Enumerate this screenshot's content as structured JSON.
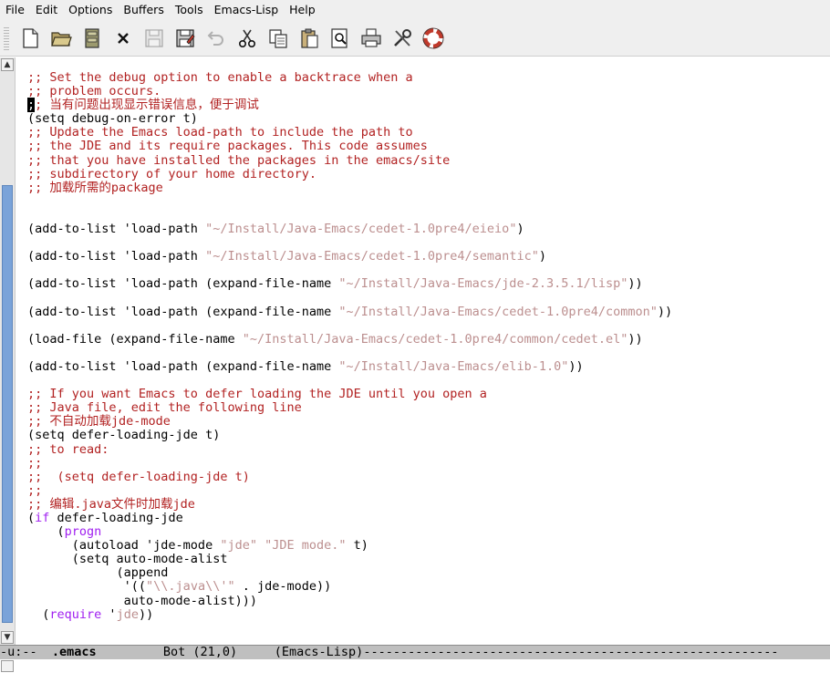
{
  "menubar": {
    "items": [
      "File",
      "Edit",
      "Options",
      "Buffers",
      "Tools",
      "Emacs-Lisp",
      "Help"
    ]
  },
  "toolbar": {
    "buttons": [
      {
        "icon": "new-file-icon"
      },
      {
        "icon": "open-folder-icon"
      },
      {
        "icon": "open-directory-icon"
      },
      {
        "icon": "close-buffer-icon"
      },
      {
        "icon": "save-icon"
      },
      {
        "icon": "save-as-icon"
      },
      {
        "icon": "undo-icon"
      },
      {
        "icon": "cut-icon"
      },
      {
        "icon": "copy-icon"
      },
      {
        "icon": "paste-icon"
      },
      {
        "icon": "search-icon"
      },
      {
        "icon": "print-icon"
      },
      {
        "icon": "preferences-icon"
      },
      {
        "icon": "help-lifebuoy-icon"
      }
    ]
  },
  "colors": {
    "comment": "#b22222",
    "string": "#bc8f8f",
    "keyword": "#a020f0",
    "scroll_thumb": "#7aa3d9"
  },
  "editor": {
    "lines": [
      [
        {
          "t": ";; Set the debug option to enable a backtrace when a",
          "c": "c"
        }
      ],
      [
        {
          "t": ";; problem occurs.",
          "c": "c"
        }
      ],
      [
        {
          "t": ";",
          "c": "cursor"
        },
        {
          "t": "; 当有问题出现显示错误信息，便于调试",
          "c": "c"
        }
      ],
      [
        {
          "t": "(setq debug-on-error t)",
          "c": ""
        }
      ],
      [
        {
          "t": ";; Update the Emacs load-path to include the path to",
          "c": "c"
        }
      ],
      [
        {
          "t": ";; the JDE and its require packages. This code assumes",
          "c": "c"
        }
      ],
      [
        {
          "t": ";; that you have installed the packages in the emacs/site",
          "c": "c"
        }
      ],
      [
        {
          "t": ";; subdirectory of your home directory.",
          "c": "c"
        }
      ],
      [
        {
          "t": ";; 加载所需的package",
          "c": "c"
        }
      ],
      [
        {
          "t": "",
          "c": ""
        }
      ],
      [
        {
          "t": "",
          "c": ""
        }
      ],
      [
        {
          "t": "(add-to-list 'load-path ",
          "c": ""
        },
        {
          "t": "\"~/Install/Java-Emacs/cedet-1.0pre4/eieio\"",
          "c": "s"
        },
        {
          "t": ")",
          "c": ""
        }
      ],
      [
        {
          "t": "",
          "c": ""
        }
      ],
      [
        {
          "t": "(add-to-list 'load-path ",
          "c": ""
        },
        {
          "t": "\"~/Install/Java-Emacs/cedet-1.0pre4/semantic\"",
          "c": "s"
        },
        {
          "t": ")",
          "c": ""
        }
      ],
      [
        {
          "t": "",
          "c": ""
        }
      ],
      [
        {
          "t": "(add-to-list 'load-path (expand-file-name ",
          "c": ""
        },
        {
          "t": "\"~/Install/Java-Emacs/jde-2.3.5.1/lisp\"",
          "c": "s"
        },
        {
          "t": "))",
          "c": ""
        }
      ],
      [
        {
          "t": "",
          "c": ""
        }
      ],
      [
        {
          "t": "(add-to-list 'load-path (expand-file-name ",
          "c": ""
        },
        {
          "t": "\"~/Install/Java-Emacs/cedet-1.0pre4/common\"",
          "c": "s"
        },
        {
          "t": "))",
          "c": ""
        }
      ],
      [
        {
          "t": "",
          "c": ""
        }
      ],
      [
        {
          "t": "(load-file (expand-file-name ",
          "c": ""
        },
        {
          "t": "\"~/Install/Java-Emacs/cedet-1.0pre4/common/cedet.el\"",
          "c": "s"
        },
        {
          "t": "))",
          "c": ""
        }
      ],
      [
        {
          "t": "",
          "c": ""
        }
      ],
      [
        {
          "t": "(add-to-list 'load-path (expand-file-name ",
          "c": ""
        },
        {
          "t": "\"~/Install/Java-Emacs/elib-1.0\"",
          "c": "s"
        },
        {
          "t": "))",
          "c": ""
        }
      ],
      [
        {
          "t": "",
          "c": ""
        }
      ],
      [
        {
          "t": ";; If you want Emacs to defer loading the JDE until you open a",
          "c": "c"
        }
      ],
      [
        {
          "t": ";; Java file, edit the following line",
          "c": "c"
        }
      ],
      [
        {
          "t": ";; 不自动加载jde-mode",
          "c": "c"
        }
      ],
      [
        {
          "t": "(setq defer-loading-jde t)",
          "c": ""
        }
      ],
      [
        {
          "t": ";; to read:",
          "c": "c"
        }
      ],
      [
        {
          "t": ";;",
          "c": "c"
        }
      ],
      [
        {
          "t": ";;  (setq defer-loading-jde t)",
          "c": "c"
        }
      ],
      [
        {
          "t": ";;",
          "c": "c"
        }
      ],
      [
        {
          "t": ";; 编辑.java文件时加载jde",
          "c": "c"
        }
      ],
      [
        {
          "t": "(",
          "c": ""
        },
        {
          "t": "if",
          "c": "k"
        },
        {
          "t": " defer-loading-jde",
          "c": ""
        }
      ],
      [
        {
          "t": "    (",
          "c": ""
        },
        {
          "t": "progn",
          "c": "k"
        }
      ],
      [
        {
          "t": "      (autoload 'jde-mode ",
          "c": ""
        },
        {
          "t": "\"jde\"",
          "c": "s"
        },
        {
          "t": " ",
          "c": ""
        },
        {
          "t": "\"JDE mode.\"",
          "c": "s"
        },
        {
          "t": " t)",
          "c": ""
        }
      ],
      [
        {
          "t": "      (setq auto-mode-alist",
          "c": ""
        }
      ],
      [
        {
          "t": "            (append",
          "c": ""
        }
      ],
      [
        {
          "t": "             '((",
          "c": ""
        },
        {
          "t": "\"\\\\.java\\\\'\"",
          "c": "s"
        },
        {
          "t": " . jde-mode))",
          "c": ""
        }
      ],
      [
        {
          "t": "             auto-mode-alist)))",
          "c": ""
        }
      ],
      [
        {
          "t": "  (",
          "c": ""
        },
        {
          "t": "require",
          "c": "k"
        },
        {
          "t": " '",
          "c": ""
        },
        {
          "t": "jde",
          "c": "s"
        },
        {
          "t": "))",
          "c": ""
        }
      ]
    ]
  },
  "modeline": {
    "status": "-u:--",
    "buffer": ".emacs",
    "position": "Bot (21,0)",
    "mode": "(Emacs-Lisp)",
    "fill": "--------------------------------------------------------"
  }
}
